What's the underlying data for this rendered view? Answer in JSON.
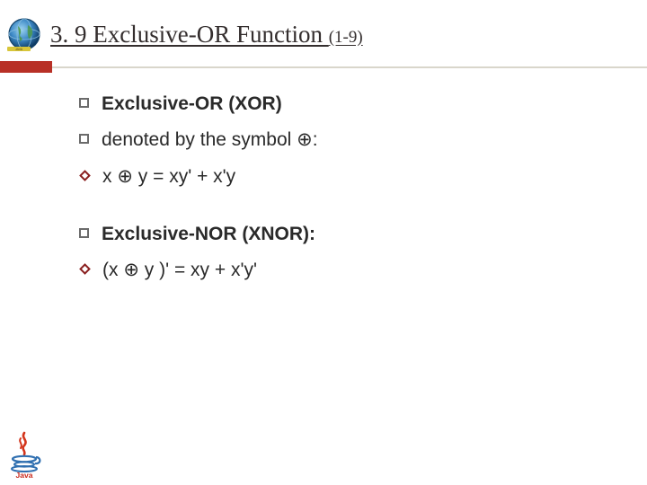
{
  "header": {
    "title_main": "3. 9 Exclusive-OR Function ",
    "title_sub": "(1-9)"
  },
  "bullets": {
    "b1": "Exclusive-OR (XOR)",
    "b2_pre": "denoted by the symbol ",
    "b2_sym": "⊕:",
    "b3_pre": "x ",
    "b3_sym": "⊕",
    "b3_post": " y = xy' + x'y",
    "b4": "Exclusive-NOR (XNOR):",
    "b5_pre": "(x ",
    "b5_sym": "⊕",
    "b5_post": " y )' = xy + x'y'"
  },
  "icons": {
    "globe": "globe-icon",
    "java": "java-logo"
  }
}
